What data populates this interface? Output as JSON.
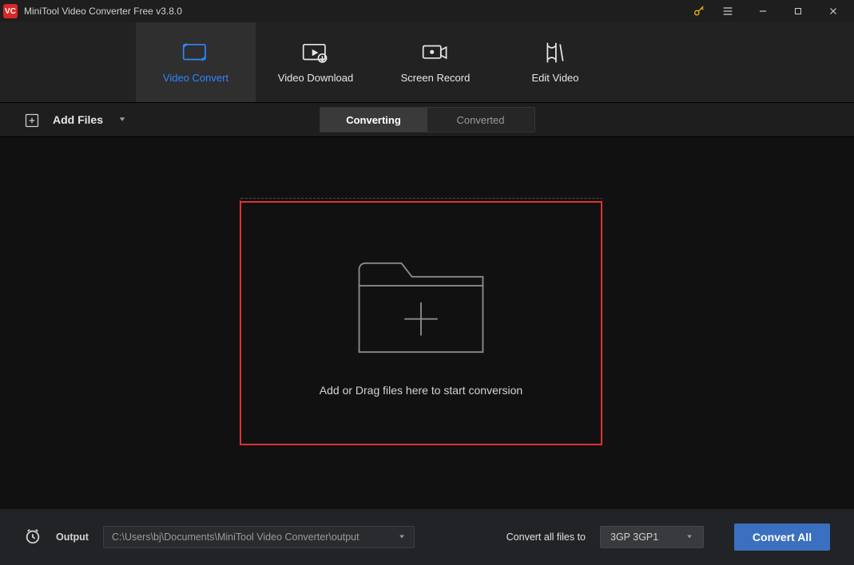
{
  "titlebar": {
    "app_icon_text": "VC",
    "title": "MiniTool Video Converter Free v3.8.0"
  },
  "mainnav": {
    "items": [
      {
        "label": "Video Convert"
      },
      {
        "label": "Video Download"
      },
      {
        "label": "Screen Record"
      },
      {
        "label": "Edit Video"
      }
    ]
  },
  "toolbar": {
    "add_files_label": "Add Files",
    "tabs": {
      "converting": "Converting",
      "converted": "Converted"
    }
  },
  "dropzone": {
    "text": "Add or Drag files here to start conversion"
  },
  "bottombar": {
    "output_label": "Output",
    "output_path": "C:\\Users\\bj\\Documents\\MiniTool Video Converter\\output",
    "convert_all_label": "Convert all files to",
    "format_selected": "3GP 3GP1",
    "convert_all_button": "Convert All"
  }
}
